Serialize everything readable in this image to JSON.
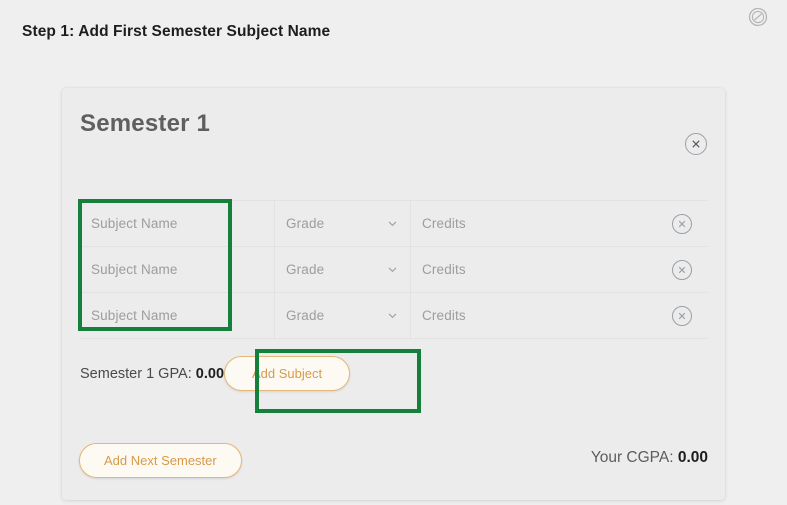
{
  "page": {
    "title": "Step 1: Add First Semester Subject Name",
    "help_icon": "help-circle-slash-icon",
    "background_color": "#efefef"
  },
  "card": {
    "heading": "Semester 1",
    "close_icon": "close-circle-icon",
    "background_color": "#ececec",
    "columns": [
      "Subject Name",
      "Grade",
      "Credits"
    ],
    "rows": [
      {
        "subject_name_value": "",
        "subject_name_placeholder": "Subject  Name",
        "grade_value": "",
        "grade_placeholder": "Grade",
        "grade_chevron_icon": "chevron-down-icon",
        "credits_value": "",
        "credits_placeholder": "Credits",
        "delete_icon": "close-circle-icon"
      },
      {
        "subject_name_value": "",
        "subject_name_placeholder": "Subject  Name",
        "grade_value": "",
        "grade_placeholder": "Grade",
        "grade_chevron_icon": "chevron-down-icon",
        "credits_value": "",
        "credits_placeholder": "Credits",
        "delete_icon": "close-circle-icon"
      },
      {
        "subject_name_value": "",
        "subject_name_placeholder": "Subject  Name",
        "grade_value": "",
        "grade_placeholder": "Grade",
        "grade_chevron_icon": "chevron-down-icon",
        "credits_value": "",
        "credits_placeholder": "Credits",
        "delete_icon": "close-circle-icon"
      }
    ],
    "gpa_label": "Semester 1 GPA: ",
    "gpa_value": "0.00",
    "add_subject_label": "Add Subject",
    "add_next_semester_label": "Add Next Semester",
    "cgpa_label": "Your CGPA: ",
    "cgpa_value": "0.00"
  },
  "annotations": {
    "color": "#14803c",
    "subject_name_box": "Subject Name column highlight",
    "add_subject_box": "Add Subject button highlight"
  }
}
